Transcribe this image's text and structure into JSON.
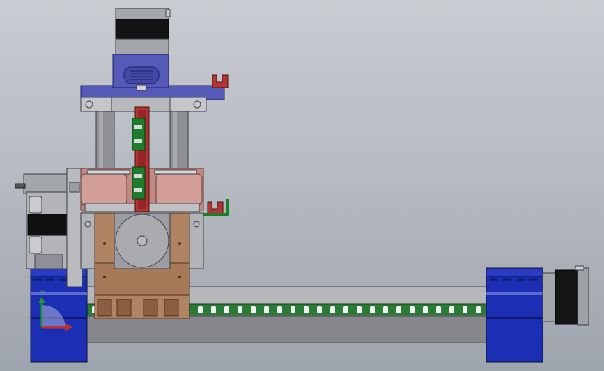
{
  "scene": {
    "description_label": "",
    "colors": {
      "background_top": "#c9ccd1",
      "background_bottom": "#9ea4ad",
      "frame_blue": "#1c2fb4",
      "plate_blue": "#5559b8",
      "carriage_tan": "#b08462",
      "roller_pink": "#c08a84",
      "rail_gray": "#8f9196",
      "motor_black": "#151515",
      "chain_red": "#b23434",
      "sensor_green": "#1e7d2a",
      "steel_gray": "#a3a6ab"
    },
    "triad": {
      "y_label": "Y",
      "x_label": ""
    }
  }
}
